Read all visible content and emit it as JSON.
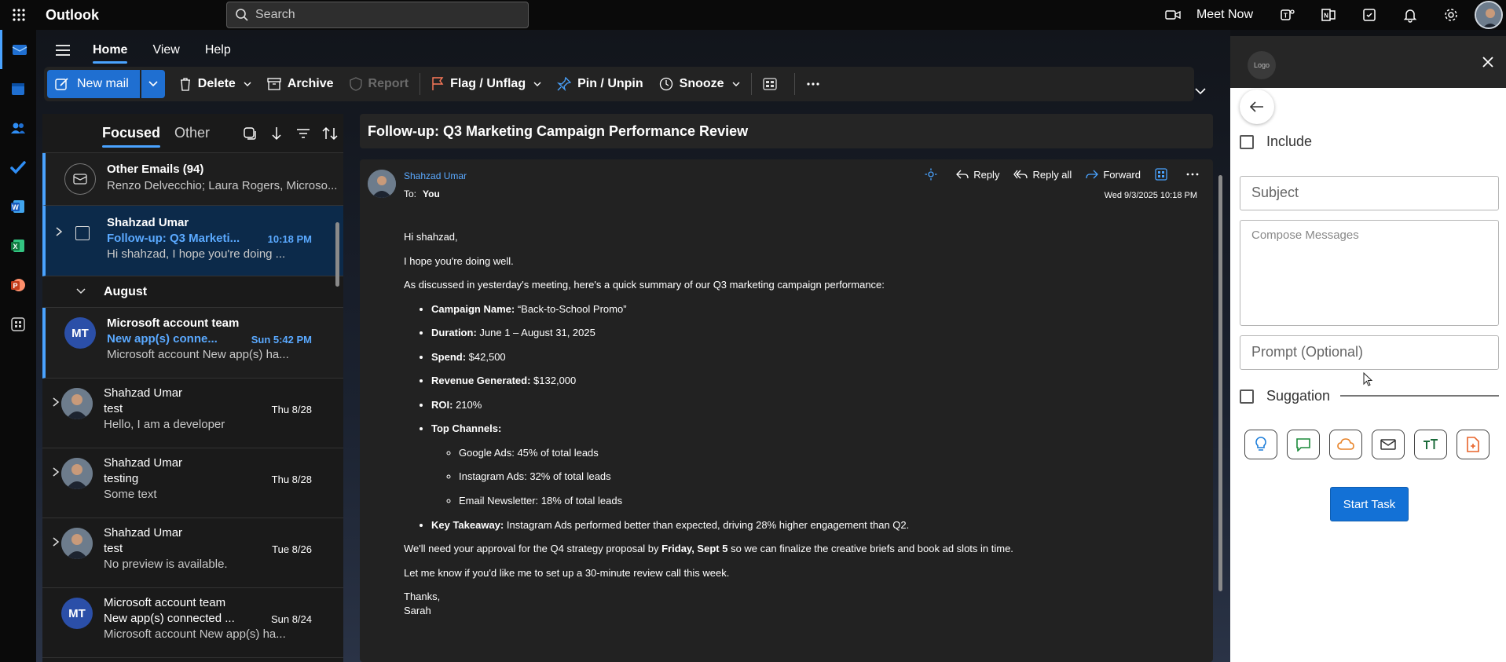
{
  "app": {
    "title": "Outlook"
  },
  "search": {
    "placeholder": "Search"
  },
  "topbar": {
    "meet_now": "Meet Now"
  },
  "ribbon": {
    "tabs": [
      "Home",
      "View",
      "Help"
    ]
  },
  "toolbar": {
    "new_mail": "New mail",
    "delete": "Delete",
    "archive": "Archive",
    "report": "Report",
    "flag": "Flag / Unflag",
    "pin": "Pin / Unpin",
    "snooze": "Snooze"
  },
  "list": {
    "focused": "Focused",
    "other": "Other",
    "other_emails": {
      "title": "Other Emails (94)",
      "preview": "Renzo Delvecchio; Laura Rogers, Microso..."
    },
    "group_august": "August",
    "items": [
      {
        "sender": "Shahzad Umar",
        "subject": "Follow-up: Q3 Marketi...",
        "time": "10:18 PM",
        "preview": "Hi shahzad, I hope you're doing ..."
      },
      {
        "avatar": "MT",
        "sender": "Microsoft account team",
        "subject": "New app(s) conne...",
        "time": "Sun 5:42 PM",
        "preview": "Microsoft account New app(s) ha..."
      },
      {
        "sender": "Shahzad Umar",
        "subject": "test",
        "time": "Thu 8/28",
        "preview": "Hello, I am a developer"
      },
      {
        "sender": "Shahzad Umar",
        "subject": "testing",
        "time": "Thu 8/28",
        "preview": "Some text"
      },
      {
        "sender": "Shahzad Umar",
        "subject": "test",
        "time": "Tue 8/26",
        "preview": "No preview is available."
      },
      {
        "avatar": "MT",
        "sender": "Microsoft account team",
        "subject": "New app(s) connected ...",
        "time": "Sun 8/24",
        "preview": "Microsoft account New app(s) ha..."
      }
    ]
  },
  "reading": {
    "subject": "Follow-up: Q3 Marketing Campaign Performance Review",
    "sender": "Shahzad Umar",
    "to_label": "To:",
    "to": "You",
    "date": "Wed 9/3/2025 10:18 PM",
    "actions": {
      "reply": "Reply",
      "reply_all": "Reply all",
      "forward": "Forward"
    },
    "body": {
      "greeting": "Hi shahzad,",
      "line1": "I hope you're doing well.",
      "line2": "As discussed in yesterday's meeting, here's a quick summary of our Q3 marketing campaign performance:",
      "campaign_label": "Campaign Name:",
      "campaign_value": " “Back-to-School Promo”",
      "duration_label": "Duration:",
      "duration_value": " June 1 – August 31, 2025",
      "spend_label": "Spend:",
      "spend_value": " $42,500",
      "revenue_label": "Revenue Generated:",
      "revenue_value": " $132,000",
      "roi_label": "ROI:",
      "roi_value": " 210%",
      "channels_label": "Top Channels:",
      "channels": [
        "Google Ads: 45% of total leads",
        "Instagram Ads: 32% of total leads",
        "Email Newsletter: 18% of total leads"
      ],
      "takeaway_label": "Key Takeaway:",
      "takeaway_value": " Instagram Ads performed better than expected, driving 28% higher engagement than Q2.",
      "approval_pre": "We'll need your approval for the Q4 strategy proposal by ",
      "approval_bold": "Friday, Sept 5",
      "approval_post": " so we can finalize the creative briefs and book ad slots in time.",
      "review": "Let me know if you'd like me to set up a 30-minute review call this week.",
      "thanks": "Thanks,",
      "signoff": "Sarah"
    }
  },
  "side": {
    "logo": "Logo",
    "include": "Include",
    "subject_placeholder": "Subject",
    "compose_placeholder": "Compose Messages",
    "prompt_placeholder": "Prompt (Optional)",
    "suggestion": "Suggation",
    "start_task": "Start Task",
    "tool_icons": [
      "lightbulb-icon",
      "chat-icon",
      "cloud-icon",
      "mail-icon",
      "text-size-icon",
      "file-add-icon"
    ]
  },
  "colors": {
    "accent": "#4aa3ff",
    "primary_button": "#1f6fd1",
    "start_task": "#1371d6"
  }
}
